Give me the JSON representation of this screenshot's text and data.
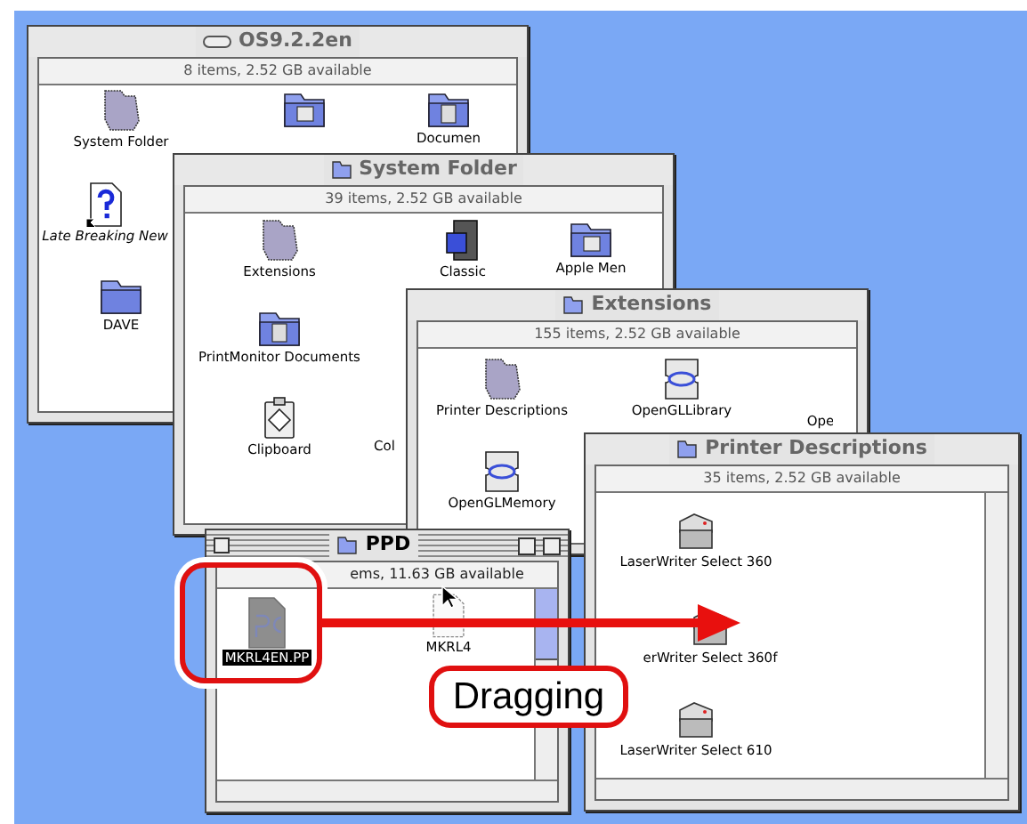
{
  "windows": [
    {
      "title": "OS9.2.2en",
      "active": false,
      "info": "8 items, 2.52 GB available",
      "items": [
        {
          "label": "System Folder",
          "kind": "system-folder",
          "alias": false,
          "selected": false
        },
        {
          "kind": "app-folder",
          "alias": false,
          "selected": false
        },
        {
          "label": "Documen",
          "kind": "doc-folder",
          "alias": false,
          "selected": false
        },
        {
          "label": "Late Breaking New",
          "kind": "help-document",
          "alias": true,
          "selected": false
        },
        {
          "label": "DAVE",
          "kind": "folder",
          "alias": false,
          "selected": false
        }
      ]
    },
    {
      "title": "System Folder",
      "active": false,
      "info": "39 items, 2.52 GB available",
      "items": [
        {
          "label": "Extensions",
          "kind": "system-folder",
          "alias": false,
          "selected": false
        },
        {
          "label": "Classic",
          "kind": "computer",
          "alias": false,
          "selected": false
        },
        {
          "label": "Apple Men",
          "kind": "app-folder",
          "alias": false,
          "selected": false
        },
        {
          "label": "PrintMonitor Documents",
          "kind": "doc-folder",
          "alias": false,
          "selected": false
        },
        {
          "label": "Clipboard",
          "kind": "clipboard",
          "alias": false,
          "selected": false
        },
        {
          "label": "Col",
          "kind": "none",
          "alias": false,
          "selected": false
        }
      ]
    },
    {
      "title": "Extensions",
      "active": false,
      "info": "155 items, 2.52 GB available",
      "items": [
        {
          "label": "Printer Descriptions",
          "kind": "system-folder",
          "alias": false,
          "selected": false
        },
        {
          "label": "OpenGLLibrary",
          "kind": "extension",
          "alias": false,
          "selected": false
        },
        {
          "label": "Ope",
          "kind": "none",
          "alias": false,
          "selected": false
        },
        {
          "label": "OpenGLMemory",
          "kind": "extension",
          "alias": false,
          "selected": false
        }
      ]
    },
    {
      "title": "PPD",
      "active": true,
      "info": "ems, 11.63 GB available",
      "items": [
        {
          "label": "MKRL4EN.PP",
          "kind": "ppd-file",
          "alias": false,
          "selected": true
        },
        {
          "label": "MKRL4",
          "kind": "ghost-file",
          "alias": false,
          "selected": false
        }
      ]
    },
    {
      "title": "Printer Descriptions",
      "active": false,
      "info": "35 items, 2.52 GB available",
      "items": [
        {
          "label": "LaserWriter Select 360",
          "kind": "printer",
          "alias": false,
          "selected": false
        },
        {
          "label": "erWriter Select 360f",
          "kind": "printer",
          "alias": false,
          "selected": false
        },
        {
          "label": "LaserWriter Select 610",
          "kind": "printer",
          "alias": false,
          "selected": false
        }
      ]
    }
  ],
  "callout": "Dragging"
}
